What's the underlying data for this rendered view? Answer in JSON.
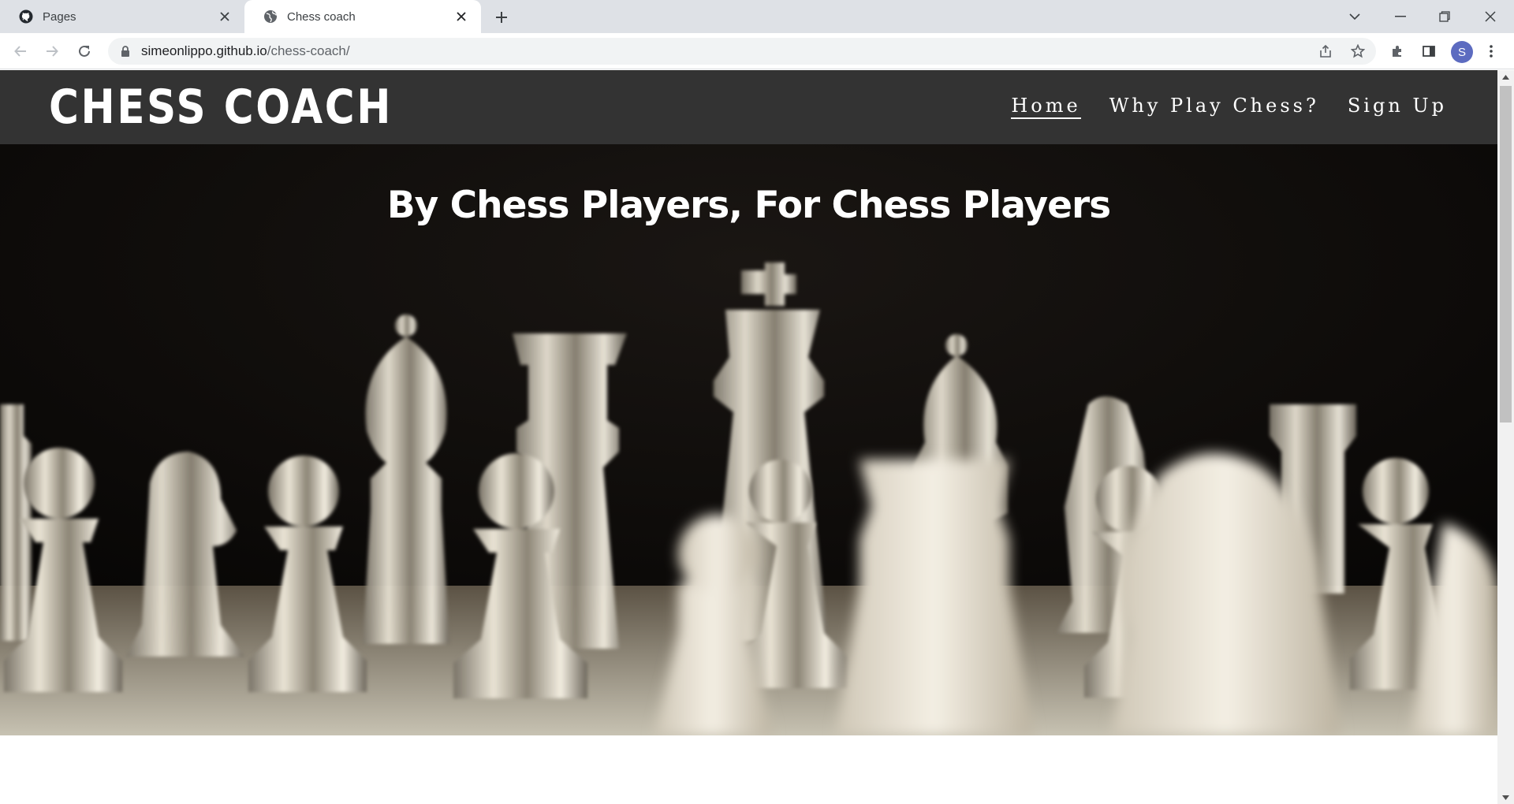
{
  "browser": {
    "tabs": [
      {
        "title": "Pages",
        "favicon": "github-icon",
        "active": false
      },
      {
        "title": "Chess coach",
        "favicon": "globe-icon",
        "active": true
      }
    ],
    "address": {
      "host": "simeonlippo.github.io",
      "path": "/chess-coach/"
    },
    "profile_initial": "S"
  },
  "site": {
    "logo": "CHESS COACH",
    "nav": [
      {
        "label": "Home",
        "current": true
      },
      {
        "label": "Why Play Chess?",
        "current": false
      },
      {
        "label": "Sign Up",
        "current": false
      }
    ],
    "hero": {
      "title": "By Chess Players, For Chess Players",
      "image": "glass-chess-pieces-photo"
    }
  },
  "colors": {
    "header_bg": "#333333",
    "tabbar_bg": "#dee1e6",
    "hero_text": "#ffffff"
  }
}
